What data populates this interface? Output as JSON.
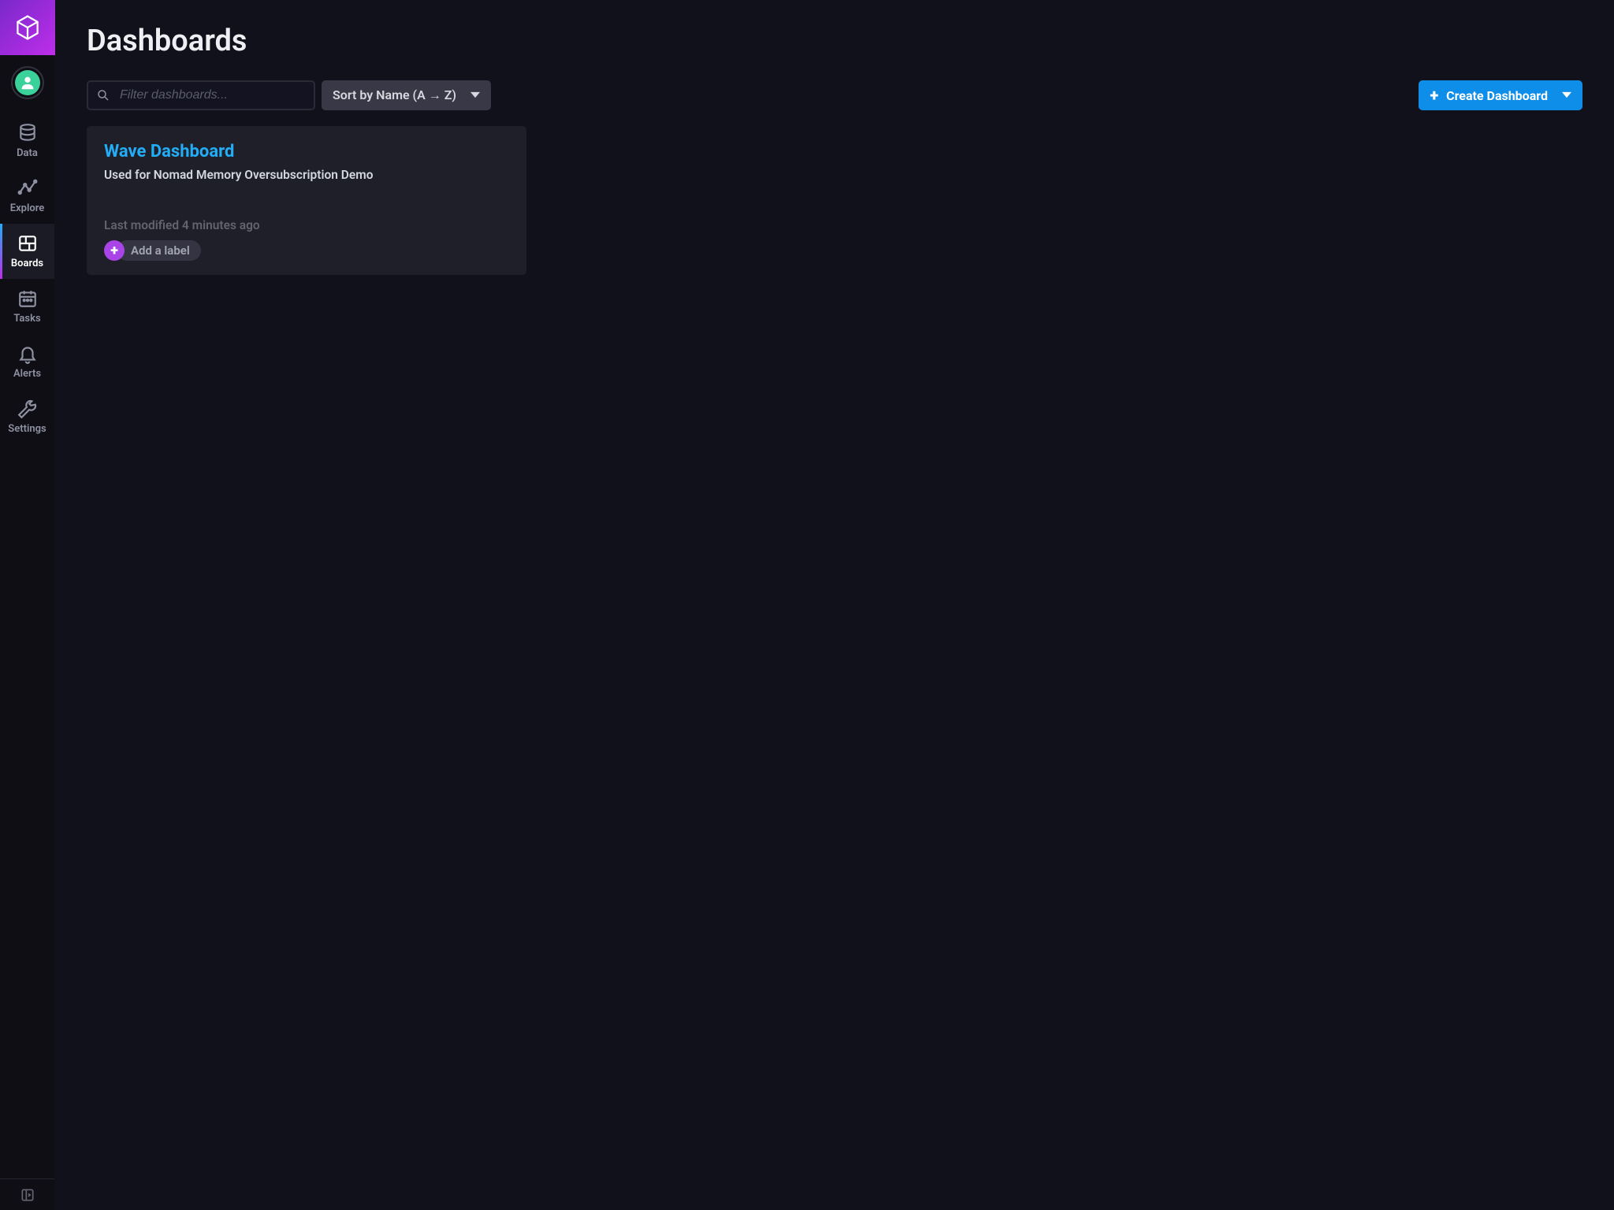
{
  "sidebar": {
    "items": [
      {
        "label": "Data"
      },
      {
        "label": "Explore"
      },
      {
        "label": "Boards"
      },
      {
        "label": "Tasks"
      },
      {
        "label": "Alerts"
      },
      {
        "label": "Settings"
      }
    ]
  },
  "page": {
    "title": "Dashboards"
  },
  "toolbar": {
    "search_placeholder": "Filter dashboards...",
    "sort_label": "Sort by Name (A → Z)",
    "create_label": "Create Dashboard"
  },
  "dashboards": [
    {
      "title": "Wave Dashboard",
      "description": "Used for Nomad Memory Oversubscription Demo",
      "last_modified": "Last modified 4 minutes ago",
      "add_label": "Add a label"
    }
  ]
}
